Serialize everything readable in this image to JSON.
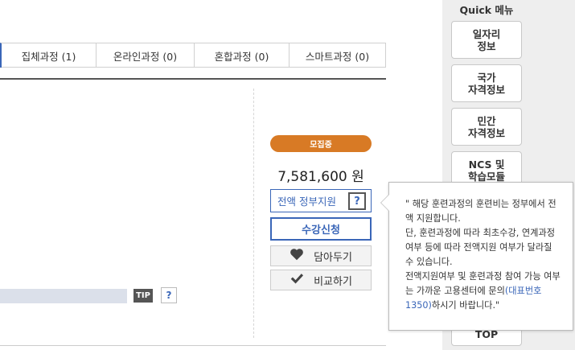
{
  "tabs": [
    {
      "label": "집체과정 (1)"
    },
    {
      "label": "온라인과정 (0)"
    },
    {
      "label": "혼합과정 (0)"
    },
    {
      "label": "스마트과정 (0)"
    }
  ],
  "course": {
    "status_badge": "모집중",
    "price": "7,581,600 원",
    "support_label": "전액 정부지원",
    "support_help": "?",
    "apply_label": "수강신청",
    "bookmark_label": "담아두기",
    "compare_label": "비교하기",
    "tip_label": "TIP",
    "tip_help": "?"
  },
  "quick_menu": {
    "title": "Quick 메뉴",
    "items": [
      {
        "label": "일자리\n정보"
      },
      {
        "label": "국가\n자격정보"
      },
      {
        "label": "민간\n자격정보"
      },
      {
        "label": "NCS 및\n학습모듈"
      }
    ],
    "top_label": "TOP"
  },
  "tooltip": {
    "line1": "\" 해당 훈련과정의 훈련비는 정부에서 전액 지원합니다.",
    "line2": "단, 훈련과정에 따라 최초수강, 연계과정 여부 등에 따라 전액지원 여부가 달라질 수 있습니다.",
    "line3_pre": "전액지원여부 및 훈련과정 참여 가능 여부는 가까운 고용센터에 문의",
    "line3_link": "(대표번호 1350)",
    "line3_post": "하시기 바랍니다.\""
  },
  "colors": {
    "accent": "#3a66b8",
    "badge": "#d87a25"
  }
}
